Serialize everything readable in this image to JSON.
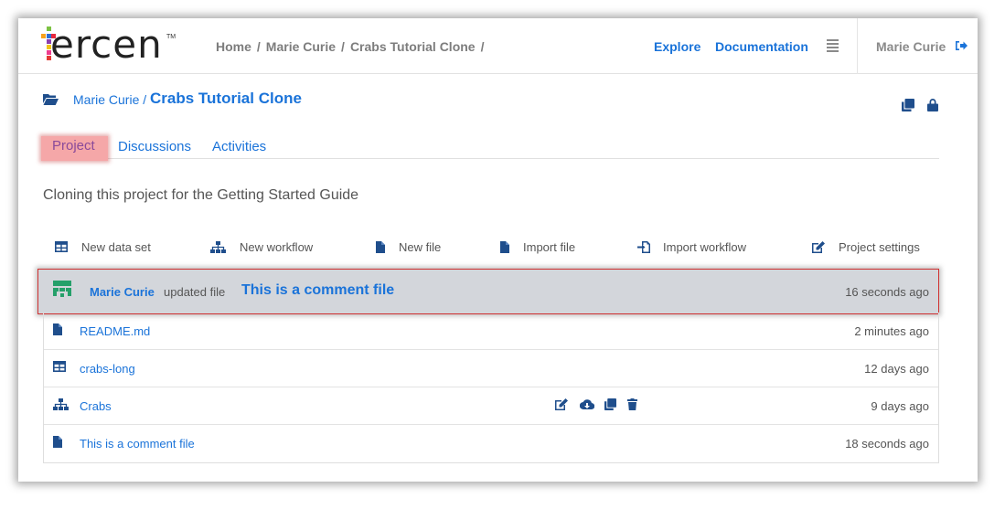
{
  "header": {
    "logo_text": "ercen",
    "logo_tm": "TM",
    "breadcrumb": [
      "Home",
      "Marie Curie",
      "Crabs Tutorial Clone"
    ],
    "breadcrumb_sep": "/",
    "explore": "Explore",
    "documentation": "Documentation",
    "user": "Marie Curie"
  },
  "project": {
    "owner": "Marie Curie /",
    "title": "Crabs Tutorial Clone",
    "description": "Cloning this project for the Getting Started Guide"
  },
  "tabs": [
    {
      "label": "Project",
      "active": true
    },
    {
      "label": "Discussions",
      "active": false
    },
    {
      "label": "Activities",
      "active": false
    }
  ],
  "toolbar": [
    {
      "label": "New data set",
      "icon": "table-icon"
    },
    {
      "label": "New workflow",
      "icon": "sitemap-icon"
    },
    {
      "label": "New file",
      "icon": "file-icon"
    },
    {
      "label": "Import file",
      "icon": "file-icon"
    },
    {
      "label": "Import workflow",
      "icon": "import-icon"
    },
    {
      "label": "Project settings",
      "icon": "edit-icon"
    }
  ],
  "activity": {
    "user": "Marie Curie",
    "verb": "updated file",
    "object": "This is a comment file",
    "time": "16 seconds ago"
  },
  "files": [
    {
      "name": "README.md",
      "time": "2 minutes ago",
      "icon": "file-icon"
    },
    {
      "name": "crabs-long",
      "time": "12 days ago",
      "icon": "table-icon"
    },
    {
      "name": "Crabs",
      "time": "9 days ago",
      "icon": "sitemap-icon"
    },
    {
      "name": "This is a comment file",
      "time": "18 seconds ago",
      "icon": "file-icon"
    }
  ],
  "colors": {
    "link": "#1a73d9",
    "activity_bg": "#d3d6db",
    "active_tab": "#f5a7a8",
    "highlight_border": "#d03030"
  }
}
